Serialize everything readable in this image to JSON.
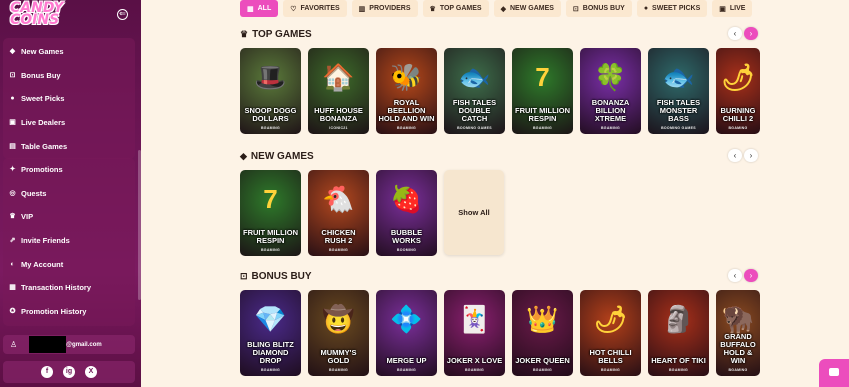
{
  "sidebar": {
    "logo_line1": "CANDY",
    "logo_line2": "COINS",
    "group1": [
      {
        "label": "New Games",
        "icon": "gem-icon"
      },
      {
        "label": "Bonus Buy",
        "icon": "cart-icon"
      },
      {
        "label": "Sweet Picks",
        "icon": "lollipop-icon"
      },
      {
        "label": "Live Dealers",
        "icon": "cards-icon"
      },
      {
        "label": "Table Games",
        "icon": "table-icon"
      }
    ],
    "group2": [
      {
        "label": "Promotions",
        "icon": "gift-icon"
      },
      {
        "label": "Quests",
        "icon": "target-icon"
      },
      {
        "label": "VIP",
        "icon": "crown-icon"
      },
      {
        "label": "Invite Friends",
        "icon": "invite-icon"
      },
      {
        "label": "My Account",
        "icon": "account-icon"
      },
      {
        "label": "Transaction History",
        "icon": "history-icon"
      },
      {
        "label": "Promotion History",
        "icon": "promo-history-icon"
      }
    ],
    "user_email_suffix": "@gmail.com",
    "social": [
      "f",
      "ig",
      "X"
    ]
  },
  "tabs": [
    {
      "label": "ALL",
      "icon": "grid-icon",
      "active": true
    },
    {
      "label": "FAVORITES",
      "icon": "heart-icon",
      "active": false
    },
    {
      "label": "PROVIDERS",
      "icon": "providers-icon",
      "active": false
    },
    {
      "label": "TOP GAMES",
      "icon": "crown-icon",
      "active": false
    },
    {
      "label": "NEW GAMES",
      "icon": "gem-icon",
      "active": false
    },
    {
      "label": "BONUS BUY",
      "icon": "cart-icon",
      "active": false
    },
    {
      "label": "SWEET PICKS",
      "icon": "lollipop-icon",
      "active": false
    },
    {
      "label": "LIVE",
      "icon": "cards-icon",
      "active": false
    }
  ],
  "sections": {
    "top_games": {
      "title": "TOP GAMES",
      "games": [
        {
          "name": "SNOOP DOGG DOLLARS",
          "provider": "BGAMING",
          "color": "#5a7a3a",
          "art": "🎩"
        },
        {
          "name": "HUFF HOUSE BONANZA",
          "provider": "ICONIC21",
          "color": "#3d6b2a",
          "art": "🏠"
        },
        {
          "name": "ROYAL BEELLION HOLD AND WIN",
          "provider": "BGAMING",
          "color": "#b5481a",
          "art": "🐝"
        },
        {
          "name": "FISH TALES DOUBLE CATCH",
          "provider": "BOOMING GAMES",
          "color": "#3d6e4a",
          "art": "🐟"
        },
        {
          "name": "FRUIT MILLION RESPIN",
          "provider": "BGAMING",
          "color": "#2e7a2a",
          "art": "7"
        },
        {
          "name": "BONANZA BILLION XTREME",
          "provider": "BGAMING",
          "color": "#7a2fa8",
          "art": "🍀"
        },
        {
          "name": "FISH TALES MONSTER BASS",
          "provider": "BOOMING GAMES",
          "color": "#2e6a6a",
          "art": "🐟"
        },
        {
          "name": "BURNING CHILLI 2",
          "provider": "BGAMING",
          "color": "#a8301a",
          "art": "🌶"
        }
      ]
    },
    "new_games": {
      "title": "NEW GAMES",
      "games": [
        {
          "name": "FRUIT MILLION RESPIN",
          "provider": "BGAMING",
          "color": "#2e7a2a",
          "art": "7"
        },
        {
          "name": "CHICKEN RUSH 2",
          "provider": "BGAMING",
          "color": "#b3481e",
          "art": "🐔"
        },
        {
          "name": "BUBBLE WORKS",
          "provider": "BOOMING",
          "color": "#7a2f9a",
          "art": "🍓"
        }
      ],
      "show_all_label": "Show All"
    },
    "bonus_buy": {
      "title": "BONUS BUY",
      "games": [
        {
          "name": "BLING BLITZ DIAMOND DROP",
          "provider": "BGAMING",
          "color": "#4a2a8a",
          "art": "💎"
        },
        {
          "name": "MUMMY'S GOLD",
          "provider": "BGAMING",
          "color": "#6a4a20",
          "art": "🤠"
        },
        {
          "name": "MERGE UP",
          "provider": "BGAMING",
          "color": "#7a2f9a",
          "art": "💠"
        },
        {
          "name": "JOKER X LOVE",
          "provider": "BGAMING",
          "color": "#8a2070",
          "art": "🃏"
        },
        {
          "name": "JOKER QUEEN",
          "provider": "BGAMING",
          "color": "#6a1a4a",
          "art": "👑"
        },
        {
          "name": "HOT CHILLI BELLS",
          "provider": "BGAMING",
          "color": "#b3401a",
          "art": "🌶"
        },
        {
          "name": "HEART OF TIKI",
          "provider": "BGAMING",
          "color": "#a8301a",
          "art": "🗿"
        },
        {
          "name": "GRAND BUFFALO HOLD & WIN",
          "provider": "BGAMING",
          "color": "#8a4a20",
          "art": "🦬"
        }
      ]
    }
  },
  "colors": {
    "accent": "#ec4dbd",
    "sidebar": "#6e1656",
    "background": "#fdf3e6"
  }
}
